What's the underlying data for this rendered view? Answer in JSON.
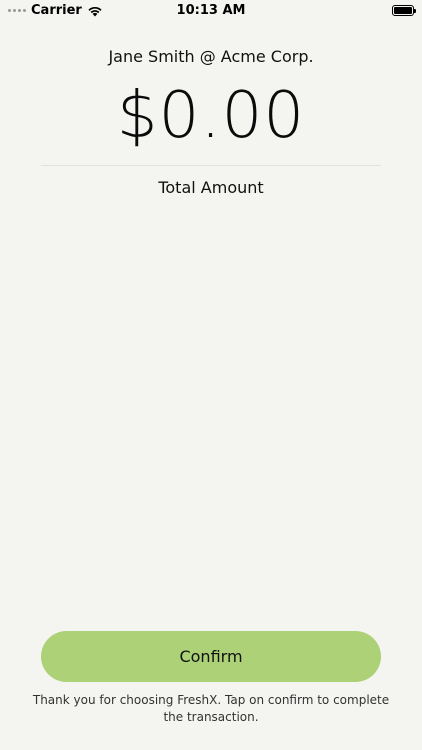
{
  "status_bar": {
    "carrier": "Carrier",
    "time": "10:13 AM",
    "icons": [
      "signal-dots-icon",
      "wifi-icon",
      "battery-icon"
    ]
  },
  "payment": {
    "merchant_line": "Jane Smith @ Acme Corp.",
    "amount": "$0.00",
    "amount_label": "Total Amount"
  },
  "actions": {
    "confirm_label": "Confirm"
  },
  "footer": {
    "note": "Thank you for choosing FreshX. Tap on confirm to complete the transaction."
  },
  "colors": {
    "background": "#f4f4f0",
    "button": "#acd176",
    "text": "#111111"
  }
}
